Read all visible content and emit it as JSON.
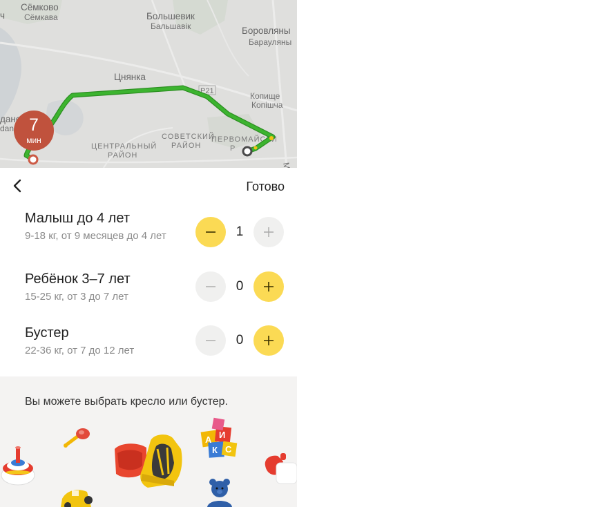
{
  "map": {
    "labels": {
      "semkovo": "Сёмково",
      "semkava": "Сёмкава",
      "bolshevik": "Большевик",
      "balshavik": "Бальшавік",
      "borovlyany": "Боровляны",
      "barauliany": "Барауляны",
      "tsnyanka": "Цнянка",
      "kopishche": "Копище",
      "kopishcha": "Копішча",
      "road_number": "Р21",
      "sovetsky_1": "СОВЕТСКИЙ",
      "sovetsky_2": "РАЙОН",
      "tsentralny_1": "ЦЕНТРАЛЬНЫЙ",
      "tsentralny_2": "РАЙОН",
      "pervomaisky_1": "ПЕРВОМАЙСКИ",
      "pervomaisky_2": "Р",
      "left_edge_1": "ч",
      "left_edge_2": "дано",
      "left_edge_3": "dan",
      "mkad": "МК"
    },
    "route_color": "#3cb42f",
    "eta": {
      "value": "7",
      "unit": "мин"
    }
  },
  "header": {
    "done_label": "Готово"
  },
  "seats": [
    {
      "title": "Малыш до 4 лет",
      "subtitle": "9-18 кг, от 9 месяцев до 4 лет",
      "count": "1"
    },
    {
      "title": "Ребёнок 3–7 лет",
      "subtitle": "15-25 кг, от 3 до 7 лет",
      "count": "0"
    },
    {
      "title": "Бустер",
      "subtitle": "22-36 кг, от 7 до 12 лет",
      "count": "0"
    }
  ],
  "info": {
    "text": "Вы можете выбрать кресло или бустер."
  },
  "colors": {
    "accent": "#fbda54",
    "inactive_button": "#f0f0ef",
    "eta_badge": "#c0523d",
    "info_background": "#f4f3f2"
  },
  "toy_blocks": {
    "letters": [
      "А",
      "И",
      "К",
      "С"
    ]
  }
}
